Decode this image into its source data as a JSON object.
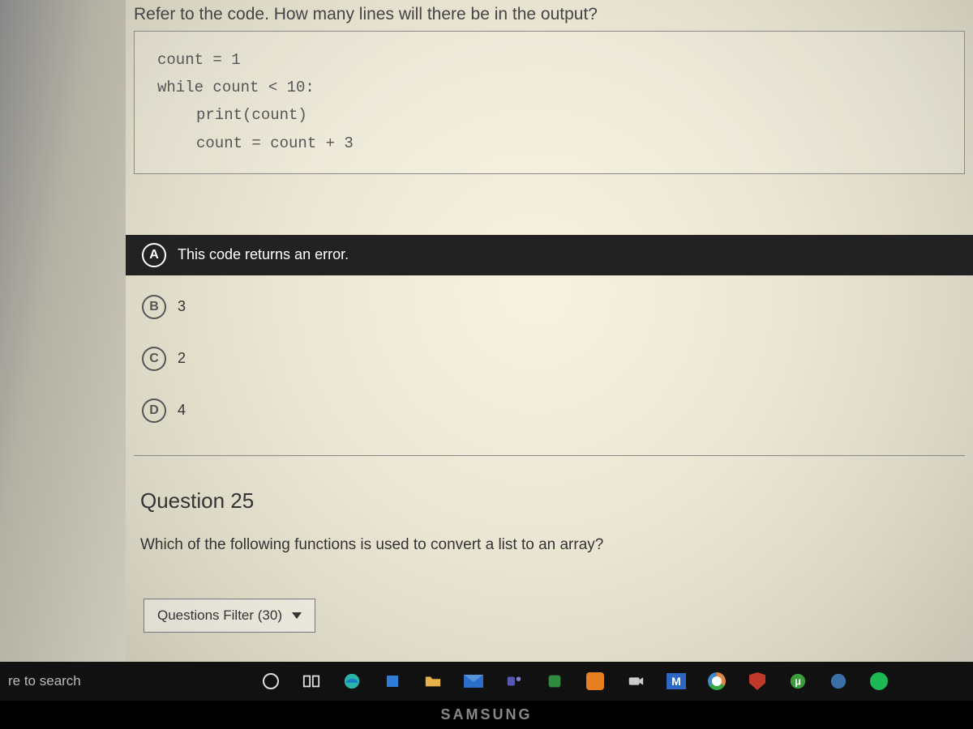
{
  "question": {
    "prompt": "Refer to the code. How many lines will there be in the output?",
    "code": [
      "count = 1",
      "while count < 10:",
      "print(count)",
      "count = count + 3"
    ],
    "options": [
      {
        "letter": "A",
        "text": "This code returns an error.",
        "selected": true
      },
      {
        "letter": "B",
        "text": "3",
        "selected": false
      },
      {
        "letter": "C",
        "text": "2",
        "selected": false
      },
      {
        "letter": "D",
        "text": "4",
        "selected": false
      }
    ]
  },
  "next_question": {
    "title": "Question 25",
    "text": "Which of the following functions is used to convert a list to an array?"
  },
  "filter": {
    "label": "Questions Filter (30)"
  },
  "taskbar": {
    "search_placeholder": "re to search"
  },
  "bezel": {
    "brand": "SAMSUNG"
  }
}
